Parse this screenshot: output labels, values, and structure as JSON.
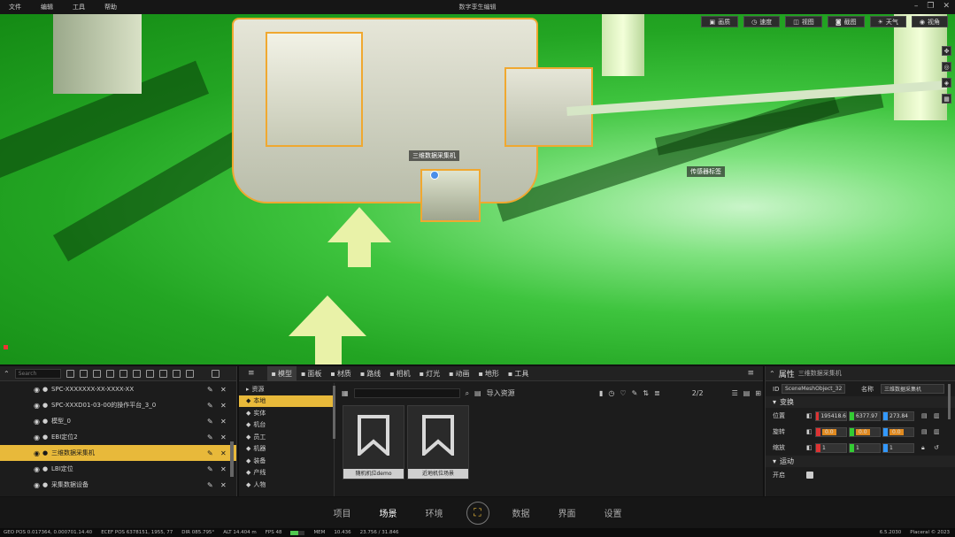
{
  "menubar": {
    "items": [
      "文件",
      "编辑",
      "工具",
      "帮助"
    ],
    "title": "数字孪生编辑"
  },
  "viewport_toolbar": {
    "buttons": [
      {
        "label": "画质",
        "icon": "display-icon"
      },
      {
        "label": "速度",
        "icon": "speed-icon"
      },
      {
        "label": "视图",
        "icon": "view-icon"
      },
      {
        "label": "截图",
        "icon": "camera-icon"
      },
      {
        "label": "天气",
        "icon": "sun-icon"
      },
      {
        "label": "视角",
        "icon": "eye-icon"
      }
    ]
  },
  "viewport": {
    "labels": [
      "三维数据采集机",
      "传感器标签"
    ]
  },
  "outliner": {
    "search_placeholder": "Search",
    "rows": [
      {
        "label": "SPC-XXXXXXX-XX-XXXX-XX",
        "selected": false
      },
      {
        "label": "SPC-XXXD01-03-00的操作平台_3_0",
        "selected": false
      },
      {
        "label": "模型_0",
        "selected": false
      },
      {
        "label": "EBI定位2",
        "selected": false
      },
      {
        "label": "三维数据采集机",
        "selected": true
      },
      {
        "label": "LBI定位",
        "selected": false
      },
      {
        "label": "采集数据设备",
        "selected": false
      },
      {
        "label": "EBI定位2",
        "selected": false
      }
    ]
  },
  "assets": {
    "tabs": [
      {
        "label": "模型",
        "icon": "cube-icon",
        "active": true
      },
      {
        "label": "面板",
        "icon": "panel-icon",
        "active": false
      },
      {
        "label": "材质",
        "icon": "material-icon",
        "active": false
      },
      {
        "label": "路线",
        "icon": "route-icon",
        "active": false
      },
      {
        "label": "相机",
        "icon": "camera-icon",
        "active": false
      },
      {
        "label": "灯光",
        "icon": "light-icon",
        "active": false
      },
      {
        "label": "动画",
        "icon": "animation-icon",
        "active": false
      },
      {
        "label": "地形",
        "icon": "terrain-icon",
        "active": false
      },
      {
        "label": "工具",
        "icon": "wrench-icon",
        "active": false
      }
    ],
    "categories": [
      {
        "label": "资源",
        "active": false
      },
      {
        "label": "本地",
        "active": true
      },
      {
        "label": "实体",
        "active": false
      },
      {
        "label": "机台",
        "active": false
      },
      {
        "label": "员工",
        "active": false
      },
      {
        "label": "机器",
        "active": false
      },
      {
        "label": "装备",
        "active": false
      },
      {
        "label": "产线",
        "active": false
      },
      {
        "label": "人物",
        "active": false
      }
    ],
    "import_label": "导入资源",
    "page_count": "2/2",
    "cards": [
      {
        "caption": "随机机位demo"
      },
      {
        "caption": "近地机位场景"
      }
    ]
  },
  "props": {
    "header_title": "属性",
    "header_object": "三维数据采集机",
    "id_label": "ID",
    "id_value": "SceneMeshObject_32",
    "name_label": "名称",
    "name_value": "三维数据采集机",
    "transform_section": "变换",
    "position_label": "位置",
    "position": {
      "x": "195418.6",
      "y": "6377.97",
      "z": "273.84"
    },
    "rotation_label": "旋转",
    "rotation": {
      "x": "0.0",
      "y": "0.0",
      "z": "0.0"
    },
    "scale_label": "缩放",
    "scale": {
      "x": "1",
      "y": "1",
      "z": "1"
    },
    "motion_section": "运动",
    "enable_label": "开启"
  },
  "bottomnav": {
    "items": [
      {
        "label": "项目",
        "active": false
      },
      {
        "label": "场景",
        "active": true
      },
      {
        "label": "环境",
        "active": false
      },
      {
        "label": "数据",
        "active": false
      },
      {
        "label": "界面",
        "active": false
      },
      {
        "label": "设置",
        "active": false
      }
    ]
  },
  "statusbar": {
    "geo": "GEO POS  0.017364, 0.000701.14.40",
    "ecef": "ECEF POS  6378151, 1955, 77",
    "dir": "DIR  085.795°",
    "alt": "ALT  14.404 m",
    "fps": "FPS  48",
    "mem_label": "MEM",
    "mem": "10.436",
    "mem_fraction": 0.55,
    "gpu": "23.756 / 31.846",
    "version": "6.5.2030",
    "copyright": "Placeral © 2023"
  },
  "colors": {
    "accent": "#e8b93a",
    "floor": "#2fb52f",
    "outline": "#f0a830"
  }
}
